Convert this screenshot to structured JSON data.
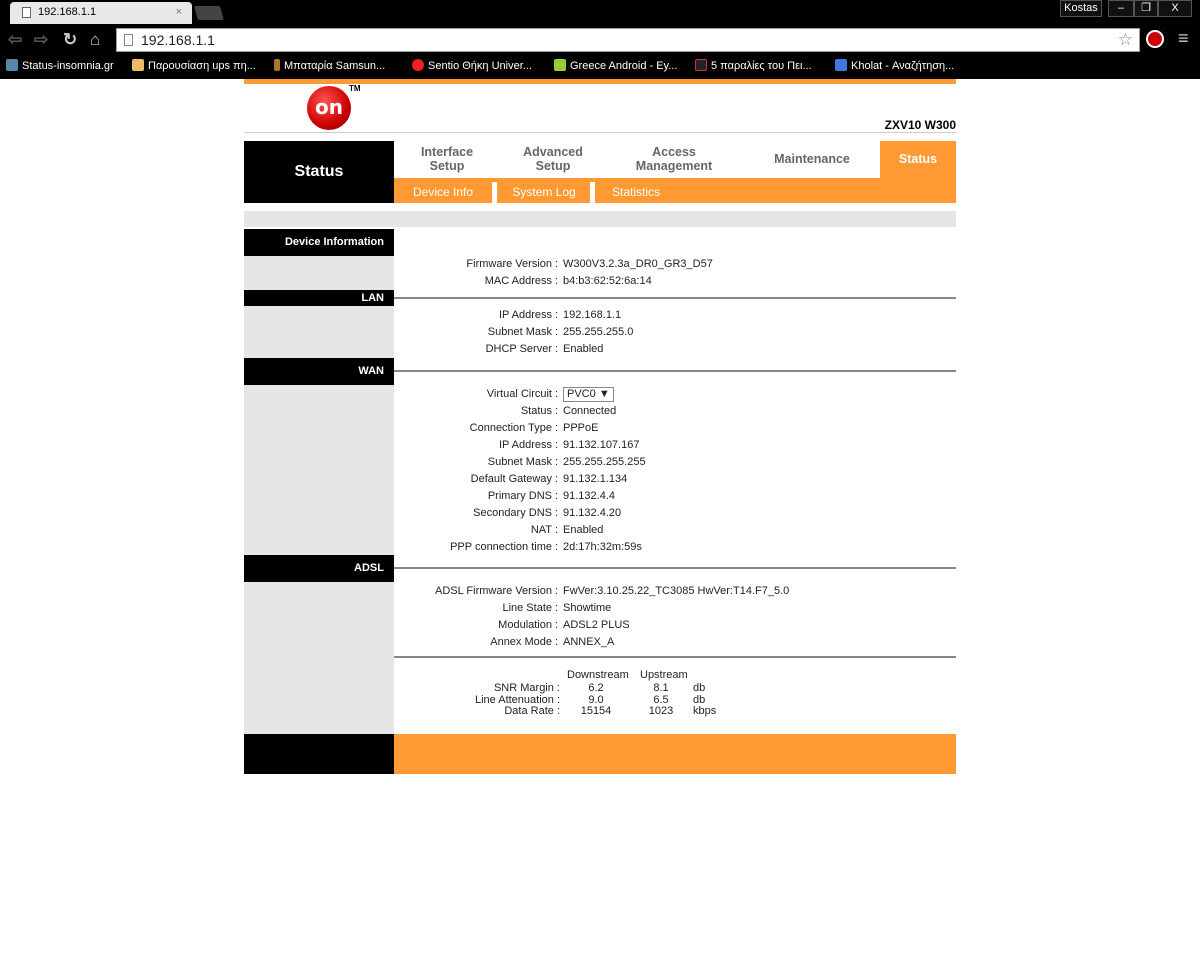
{
  "browser": {
    "tab_title": "192.168.1.1",
    "url": "192.168.1.1",
    "user": "Kostas",
    "bookmarks": [
      "Status-insomnia.gr",
      "Παρουσίαση ups πη...",
      "Μπαταρία Samsun...",
      "Sentio Θήκη Univer...",
      "Greece Android - Εy...",
      "5 παραλίες του Πει...",
      "Kholat - Αναζήτηση..."
    ]
  },
  "header": {
    "logo": "on",
    "trademark": "TM",
    "model": "ZXV10 W300",
    "section": "Status"
  },
  "menu": [
    "Interface\nSetup",
    "Advanced\nSetup",
    "Access\nManagement",
    "Maintenance",
    "Status"
  ],
  "submenu": [
    "Device Info",
    "System Log",
    "Statistics"
  ],
  "sections": {
    "device": {
      "title": "Device Information",
      "rows": [
        [
          "Firmware Version",
          "W300V3.2.3a_DR0_GR3_D57"
        ],
        [
          "MAC Address",
          "b4:b3:62:52:6a:14"
        ]
      ]
    },
    "lan": {
      "title": "LAN",
      "rows": [
        [
          "IP Address",
          "192.168.1.1"
        ],
        [
          "Subnet Mask",
          "255.255.255.0"
        ],
        [
          "DHCP Server",
          "Enabled"
        ]
      ]
    },
    "wan": {
      "title": "WAN",
      "virtual_circuit_label": "Virtual Circuit",
      "virtual_circuit": "PVC0",
      "rows": [
        [
          "Status",
          "Connected"
        ],
        [
          "Connection Type",
          "PPPoE"
        ],
        [
          "IP Address",
          "91.132.107.167"
        ],
        [
          "Subnet Mask",
          "255.255.255.255"
        ],
        [
          "Default Gateway",
          "91.132.1.134"
        ],
        [
          "Primary DNS",
          "91.132.4.4"
        ],
        [
          "Secondary DNS",
          "91.132.4.20"
        ],
        [
          "NAT",
          "Enabled"
        ],
        [
          "PPP connection time",
          "2d:17h:32m:59s"
        ]
      ]
    },
    "adsl": {
      "title": "ADSL",
      "rows": [
        [
          "ADSL Firmware Version",
          "FwVer:3.10.25.22_TC3085 HwVer:T14.F7_5.0"
        ],
        [
          "Line State",
          "Showtime"
        ],
        [
          "Modulation",
          "ADSL2 PLUS"
        ],
        [
          "Annex Mode",
          "ANNEX_A"
        ]
      ],
      "stats": {
        "headers": [
          "Downstream",
          "Upstream"
        ],
        "rows": [
          [
            "SNR Margin :",
            "6.2",
            "8.1",
            "db"
          ],
          [
            "Line Attenuation :",
            "9.0",
            "6.5",
            "db"
          ],
          [
            "Data Rate :",
            "15154",
            "1023",
            "kbps"
          ]
        ]
      }
    }
  }
}
